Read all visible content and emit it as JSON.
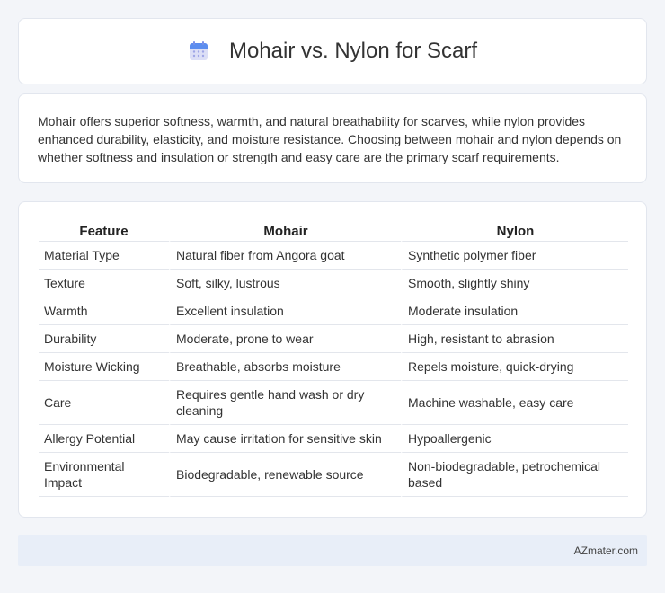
{
  "header": {
    "title": "Mohair vs. Nylon for Scarf",
    "icon": "calendar-icon"
  },
  "summary": {
    "text": "Mohair offers superior softness, warmth, and natural breathability for scarves, while nylon provides enhanced durability, elasticity, and moisture resistance. Choosing between mohair and nylon depends on whether softness and insulation or strength and easy care are the primary scarf requirements."
  },
  "table": {
    "headers": [
      "Feature",
      "Mohair",
      "Nylon"
    ],
    "rows": [
      [
        "Material Type",
        "Natural fiber from Angora goat",
        "Synthetic polymer fiber"
      ],
      [
        "Texture",
        "Soft, silky, lustrous",
        "Smooth, slightly shiny"
      ],
      [
        "Warmth",
        "Excellent insulation",
        "Moderate insulation"
      ],
      [
        "Durability",
        "Moderate, prone to wear",
        "High, resistant to abrasion"
      ],
      [
        "Moisture Wicking",
        "Breathable, absorbs moisture",
        "Repels moisture, quick-drying"
      ],
      [
        "Care",
        "Requires gentle hand wash or dry cleaning",
        "Machine washable, easy care"
      ],
      [
        "Allergy Potential",
        "May cause irritation for sensitive skin",
        "Hypoallergenic"
      ],
      [
        "Environmental Impact",
        "Biodegradable, renewable source",
        "Non-biodegradable, petrochemical based"
      ]
    ]
  },
  "footer": {
    "brand": "AZmater.com"
  },
  "colors": {
    "background": "#f3f5f9",
    "card": "#ffffff",
    "footer_bg": "#e8eef8",
    "icon_top": "#5b8def",
    "icon_body": "#d9dcf5",
    "icon_dots": "#9fa6e6"
  }
}
